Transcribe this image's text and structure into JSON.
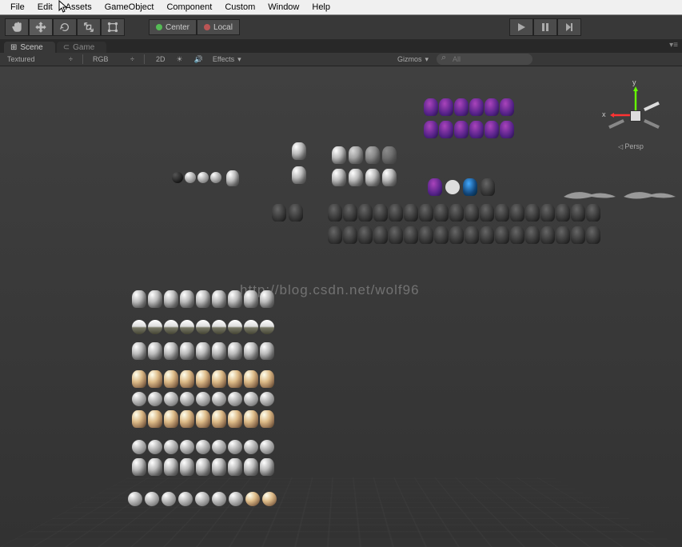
{
  "menu": {
    "file": "File",
    "edit": "Edit",
    "assets": "Assets",
    "gameobject": "GameObject",
    "component": "Component",
    "custom": "Custom",
    "window": "Window",
    "help": "Help"
  },
  "toolbar": {
    "center": "Center",
    "local": "Local"
  },
  "tabs": {
    "scene": "Scene",
    "game": "Game"
  },
  "scene_bar": {
    "shading": "Textured",
    "rgb": "RGB",
    "twod": "2D",
    "effects": "Effects",
    "gizmos": "Gizmos",
    "search_placeholder": "All"
  },
  "gizmo": {
    "y": "y",
    "x": "x",
    "persp": "Persp"
  },
  "watermark": "http://blog.csdn.net/wolf96"
}
